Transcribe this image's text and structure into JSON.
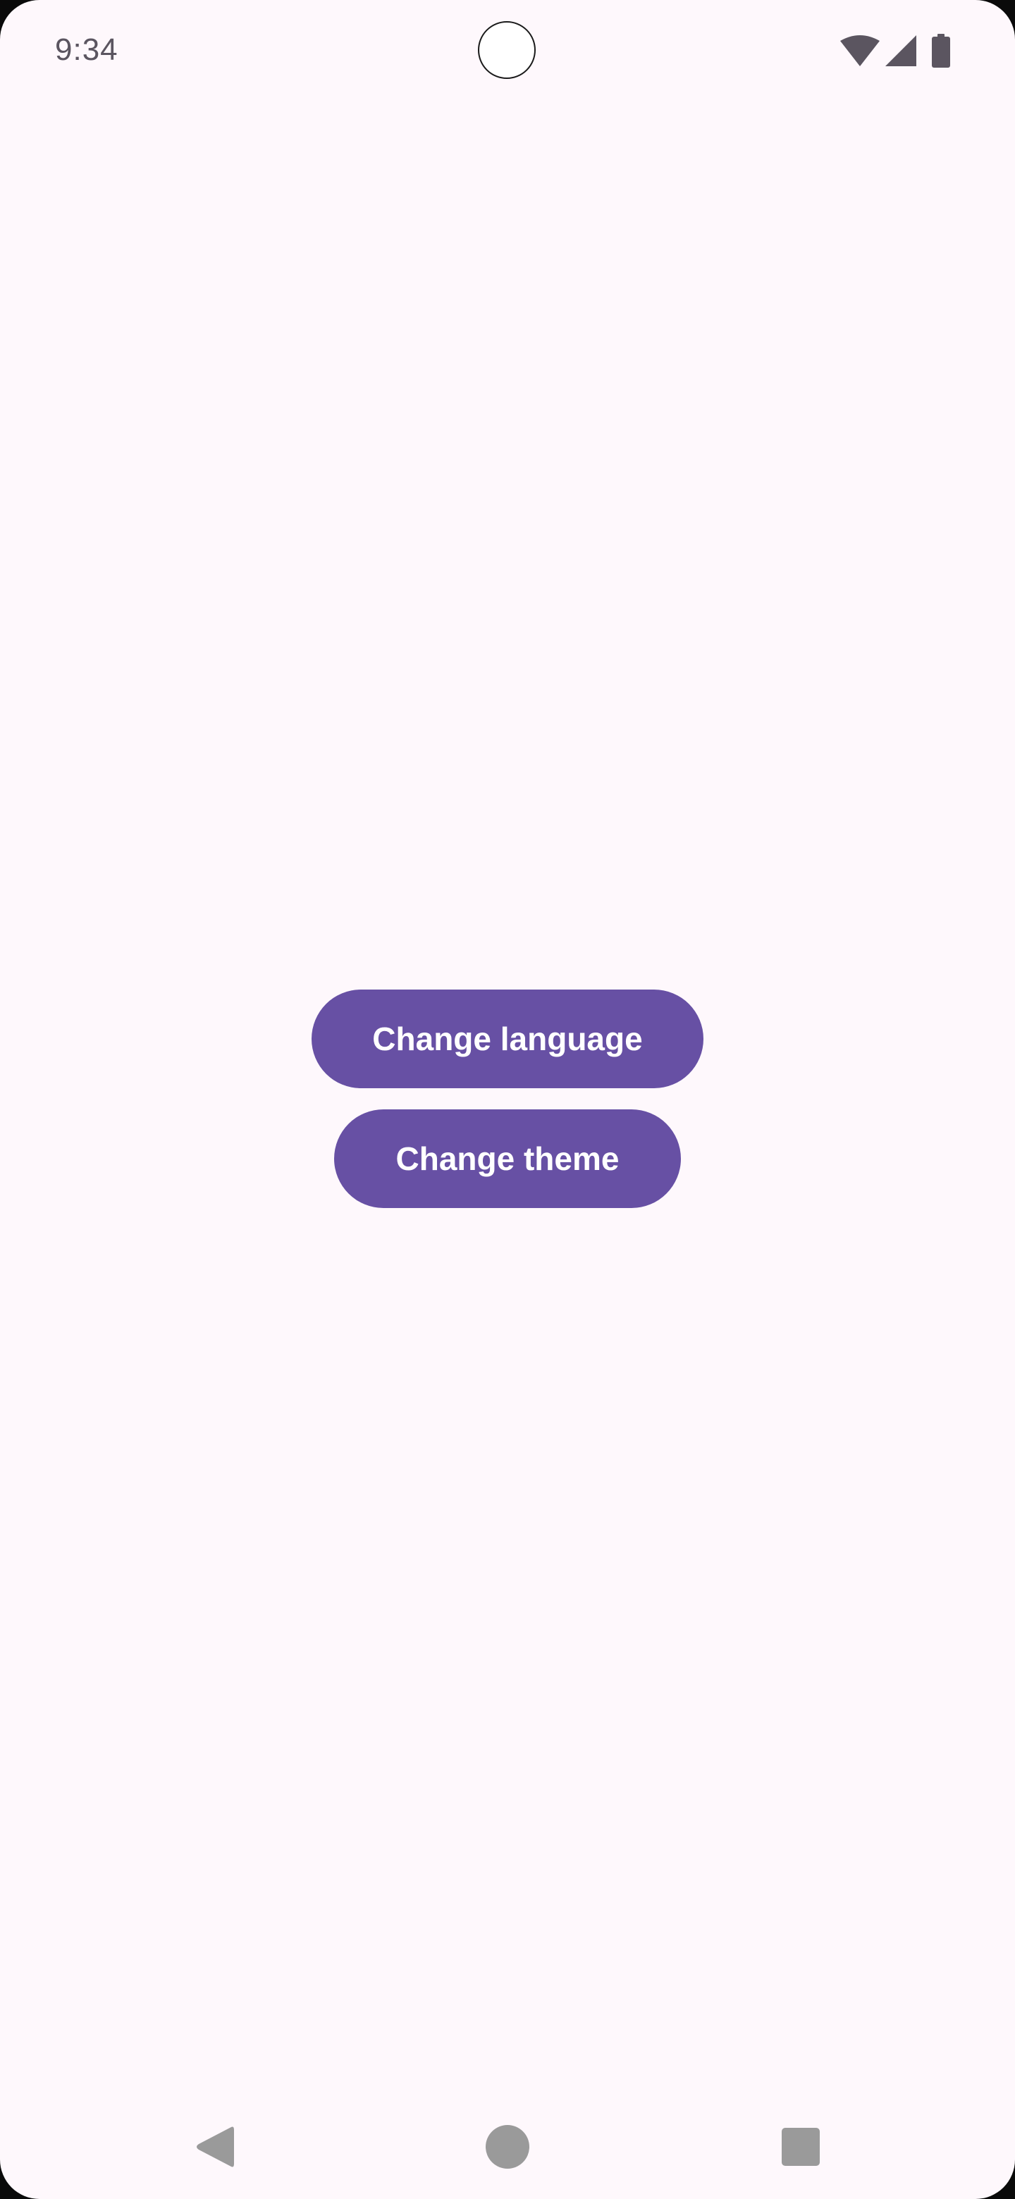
{
  "status_bar": {
    "time": "9:34",
    "icons": [
      "wifi-icon",
      "cell-signal-icon",
      "battery-icon"
    ],
    "icon_color": "#5b5560"
  },
  "main": {
    "buttons": [
      {
        "label": "Change language"
      },
      {
        "label": "Change theme"
      }
    ],
    "accent_color": "#6750a4",
    "background_color": "#fef8fc"
  },
  "navigation_bar": {
    "buttons": [
      "back-icon",
      "home-icon",
      "recents-icon"
    ],
    "icon_color": "#9a9a9a"
  }
}
